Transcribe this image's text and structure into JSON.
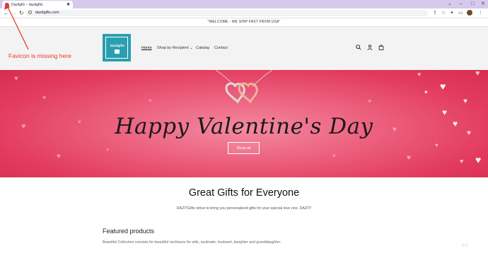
{
  "browser": {
    "tab_title": "Dazitgifs – dazitgifts",
    "new_tab": "+",
    "url": "dazitgifts.com",
    "win_min": "–",
    "win_max": "□",
    "win_close": "✕",
    "chevron": "⌄"
  },
  "announcement": "\"WELCOME - WE SHIP FAST FROM USA\"",
  "header": {
    "logo_text": "Dazitgifts",
    "nav": [
      "Home",
      "Shop by Recipient",
      "Catalog",
      "Contact"
    ],
    "nav_dropdown_icon": "⌄"
  },
  "hero": {
    "title": "Happy Valentine's Day",
    "button": "Shop all"
  },
  "content": {
    "title": "Great Gifts for Everyone",
    "description": "DAZITGifts strive to bring you personalized gifts for your special love one. DAZIT!",
    "featured_title": "Featured products",
    "featured_desc": "Beautiful Collection consists for beautiful necklaces for wife, soulmate, husband, daughter and granddaughter."
  },
  "annotation": "Favicon is missing here",
  "colors": {
    "tabbar": "#d6c9ec",
    "logo_bg": "#2a9fb0",
    "hero_pink": "#e23a5e",
    "annotation": "#e8392f"
  }
}
